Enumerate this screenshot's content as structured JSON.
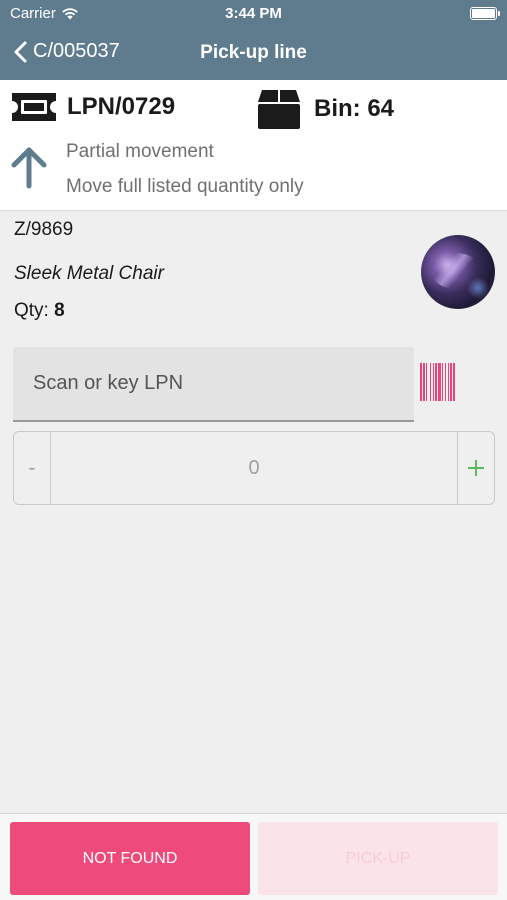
{
  "status_bar": {
    "carrier": "Carrier",
    "time": "3:44 PM"
  },
  "nav": {
    "back_label": "C/005037",
    "title": "Pick-up line"
  },
  "header": {
    "lpn": "LPN/0729",
    "bin": "Bin: 64",
    "movement_title": "Partial movement",
    "movement_subtitle": "Move full listed quantity only"
  },
  "item": {
    "code": "Z/9869",
    "name": "Sleek Metal Chair",
    "qty_label": "Qty:",
    "qty_value": "8"
  },
  "scan": {
    "placeholder": "Scan or key LPN"
  },
  "stepper": {
    "minus": "-",
    "value": "0"
  },
  "buttons": {
    "not_found": "NOT FOUND",
    "pick_up": "PICK-UP"
  },
  "colors": {
    "header_bg": "#5f7b8e",
    "accent": "#ef4a7c",
    "accent_disabled": "#fbe3ea",
    "plus": "#5cb85c"
  },
  "icons": [
    "wifi-icon",
    "battery-icon",
    "chevron-left-icon",
    "ticket-icon",
    "box-icon",
    "arrow-up-icon",
    "barcode-icon",
    "plus-icon"
  ]
}
